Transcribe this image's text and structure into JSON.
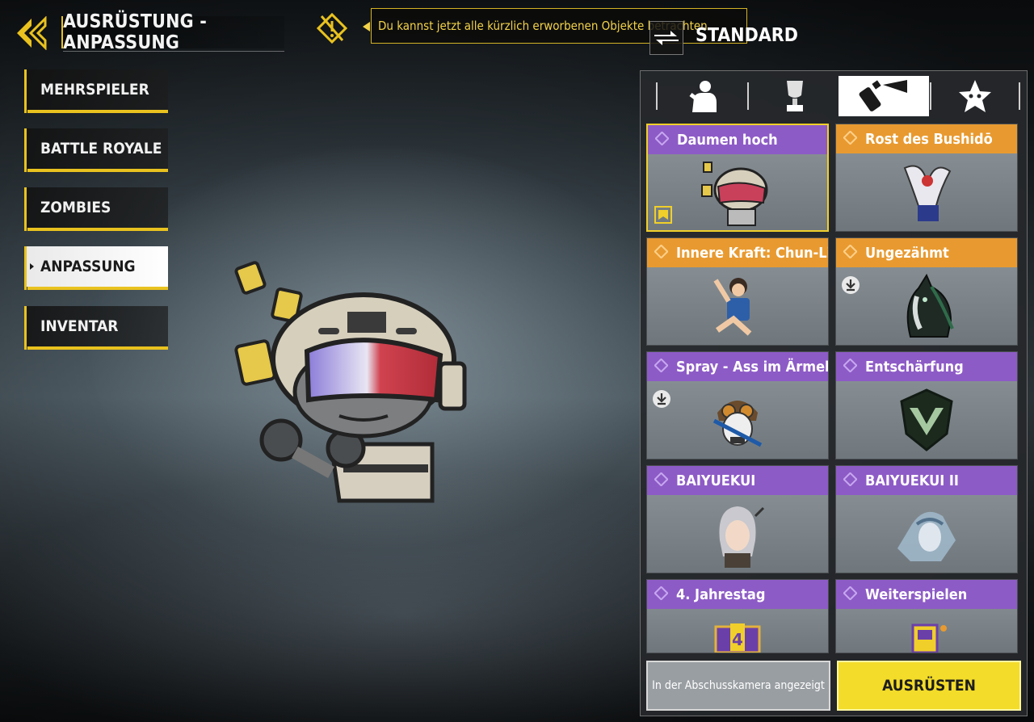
{
  "header": {
    "title": "AUSRÜSTUNG - ANPASSUNG",
    "banner_text": "Du kannst jetzt alle kürzlich erworbenen Objekte betrachten",
    "loadout_label": "STANDARD"
  },
  "sidebar": {
    "items": [
      {
        "label": "MEHRSPIELER",
        "active": false
      },
      {
        "label": "BATTLE ROYALE",
        "active": false
      },
      {
        "label": "ZOMBIES",
        "active": false
      },
      {
        "label": "ANPASSUNG",
        "active": true
      },
      {
        "label": "INVENTAR",
        "active": false
      }
    ]
  },
  "tabs": [
    {
      "icon": "character-icon",
      "active": false
    },
    {
      "icon": "trophy-icon",
      "active": false
    },
    {
      "icon": "spray-can-icon",
      "active": true
    },
    {
      "icon": "star-icon",
      "active": false
    }
  ],
  "items": [
    {
      "name": "Daumen hoch",
      "rarity": "purple",
      "selected": true,
      "favorite": true
    },
    {
      "name": "Rost des Bushidō",
      "rarity": "orange"
    },
    {
      "name": "Innere Kraft: Chun-Li",
      "rarity": "orange"
    },
    {
      "name": "Ungezähmt",
      "rarity": "orange",
      "download": true
    },
    {
      "name": "Spray - Ass im Ärmel",
      "rarity": "purple",
      "download": true
    },
    {
      "name": "Entschärfung",
      "rarity": "purple"
    },
    {
      "name": "BAIYUEKUI",
      "rarity": "purple"
    },
    {
      "name": "BAIYUEKUI II",
      "rarity": "purple"
    },
    {
      "name": "4. Jahrestag",
      "rarity": "purple"
    },
    {
      "name": "Weiterspielen",
      "rarity": "purple"
    }
  ],
  "actions": {
    "killcam_label": "In der Abschusskamera angezeigt",
    "equip_label": "AUSRÜSTEN"
  },
  "colors": {
    "accent_yellow": "#e9c21f",
    "rarity_purple": "#8d5bc6",
    "rarity_orange": "#e89a30"
  }
}
